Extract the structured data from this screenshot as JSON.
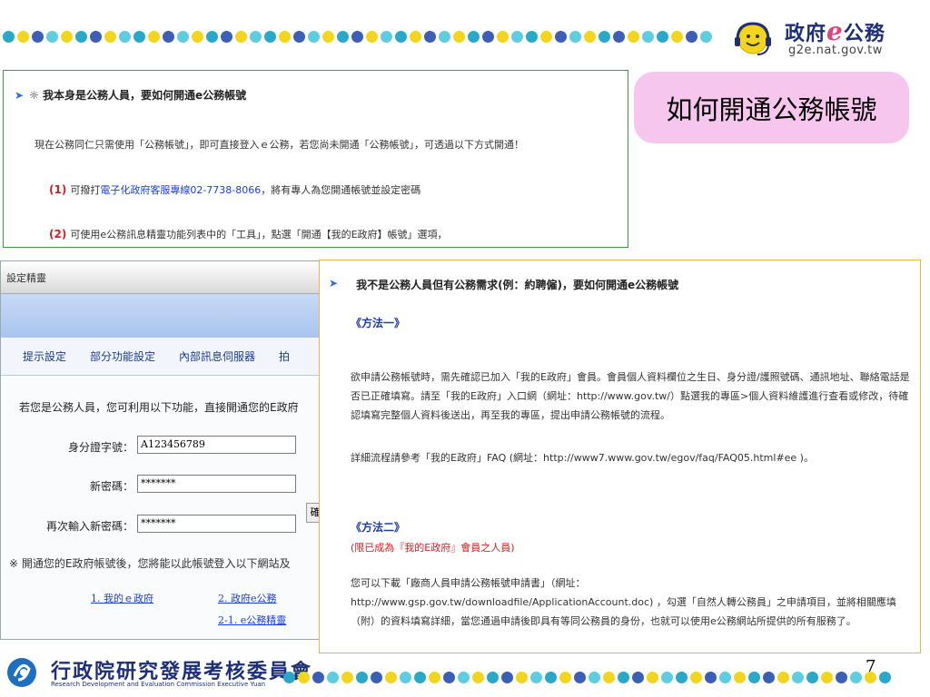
{
  "header": {
    "logo_title_left": "政府",
    "logo_title_e": "e",
    "logo_title_right": "公務",
    "logo_url": "g2e.nat.gov.tw"
  },
  "slide_title": "如何開通公務帳號",
  "section1": {
    "question": "☼ 我本身是公務人員，要如何開通e公務帳號",
    "intro": "現在公務同仁只需使用「公務帳號」，即可直接登入ｅ公務，若您尚未開通「公務帳號」，可透過以下方式開通！",
    "step1_num": "(1)",
    "step1_prefix": "可撥打",
    "step1_link": "電子化政府客服專線02-7738-8066",
    "step1_suffix": "，將有專人為您開通帳號並設定密碼",
    "step2_num": "(2)",
    "step2_text": "可使用e公務訊息精靈功能列表中的「工具」，點選「開通【我的E政府】帳號」選項，"
  },
  "dialog": {
    "title": "設定精靈",
    "tabs": [
      "提示設定",
      "部分功能設定",
      "內部訊息伺服器",
      "拍"
    ],
    "intro": "若您是公務人員，您可利用以下功能，直接開通您的E政府",
    "id_label": "身分證字號：",
    "id_value": "A123456789",
    "pw_label": "新密碼：",
    "pw_value": "*******",
    "pw2_label": "再次輸入新密碼：",
    "pw2_value": "*******",
    "button_label": "確",
    "note": "※ 開通您的E政府帳號後，您將能以此帳號登入以下網站及",
    "links": [
      "1. 我的ｅ政府",
      "2. 政府e公務",
      "2-1. e公務精靈"
    ]
  },
  "section2": {
    "question": "我不是公務人員但有公務需求(例：約聘僱)，要如何開通e公務帳號",
    "method1": "《方法一》",
    "method1_para1": "欲申請公務帳號時，需先確認已加入「我的E政府」會員。會員個人資料欄位之生日、身分證/護照號碼、通訊地址、聯絡電話是否已正確填寫。請至「我的E政府」入口網（網址：http://www.gov.tw/）點選我的專區>個人資料維護進行查看或修改，待確認填寫完整個人資料後送出，再至我的專區，提出申請公務帳號的流程。",
    "method1_para2": "詳細流程請參考「我的E政府」FAQ (網址：http://www7.www.gov.tw/egov/faq/FAQ05.html#ee )。",
    "method2": "《方法二》",
    "method2_note": "(限已成為『我的E政府』會員之人員)",
    "method2_line1": "您可以下載「廠商人員申請公務帳號申請書」（網址：",
    "method2_para": "http://www.gsp.gov.tw/downloadfile/ApplicationAccount.doc) ，勾選「自然人轉公務員」之申請項目，並將相關應填（附）的資料填寫詳細，當您通過申請後即具有等同公務員的身份，也就可以使用e公務網站所提供的所有服務了。"
  },
  "footer": {
    "org_name": "行政院研究發展考核委員會",
    "org_name_en": "Research Development and Evaluation Commission Executive Yuan",
    "page_number": "7"
  },
  "colors": {
    "dot_cycle": [
      "#2aa8c9",
      "#f2d51c",
      "#3b5fb5",
      "#5fcde0",
      "#f2d51c",
      "#2aa8c9",
      "#3b5fb5",
      "#f2d51c",
      "#5fcde0"
    ],
    "accent_green": "#3a9d3a",
    "accent_orange": "#f1b24a",
    "bubble_pink": "#f7c6ee",
    "link_blue": "#1a3fd8",
    "step_red": "#d42020"
  }
}
